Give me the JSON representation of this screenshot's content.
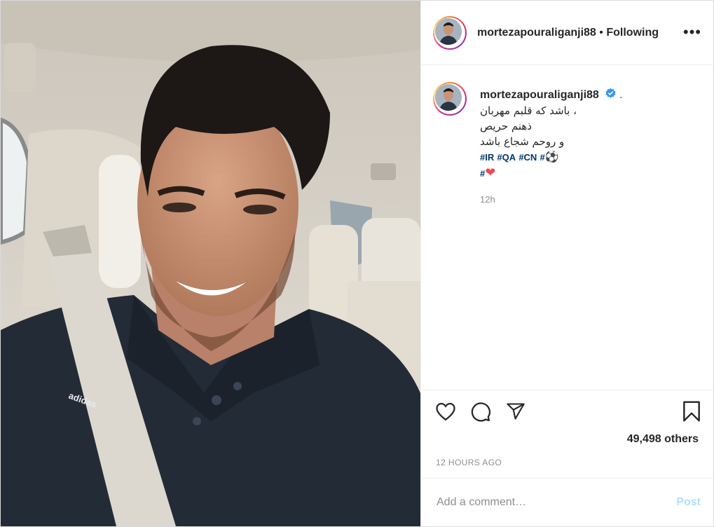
{
  "post": {
    "image_alt": "selfie-in-car",
    "brand_text": "adidas"
  },
  "header": {
    "username": "mortezapouraliganji88",
    "separator": "•",
    "following_label": "Following",
    "more_label": "•••"
  },
  "caption": {
    "username": "mortezapouraliganji88",
    "trailing": ".",
    "lines": [
      "، باشد که قلبم مهربان",
      "ذهنم حریص",
      "و روحم شجاع باشد"
    ],
    "hashtags": [
      "#IR",
      "#QA",
      "#CN",
      "#"
    ],
    "hashtag_emoji": "⚽",
    "heart_tag": "#",
    "heart_emoji": "❤",
    "relative_time": "12h"
  },
  "engagement": {
    "likes_text": "49,498 others",
    "posted_time": "12 HOURS AGO"
  },
  "comment": {
    "placeholder": "Add a comment…",
    "post_label": "Post"
  },
  "icons": [
    "heart-icon",
    "comment-icon",
    "share-icon",
    "bookmark-icon",
    "verified-badge-icon"
  ],
  "colors": {
    "verified": "#3897f0",
    "hashtag": "#00376b",
    "post_button_disabled": "#b2dffc",
    "heart": "#ed4956"
  }
}
